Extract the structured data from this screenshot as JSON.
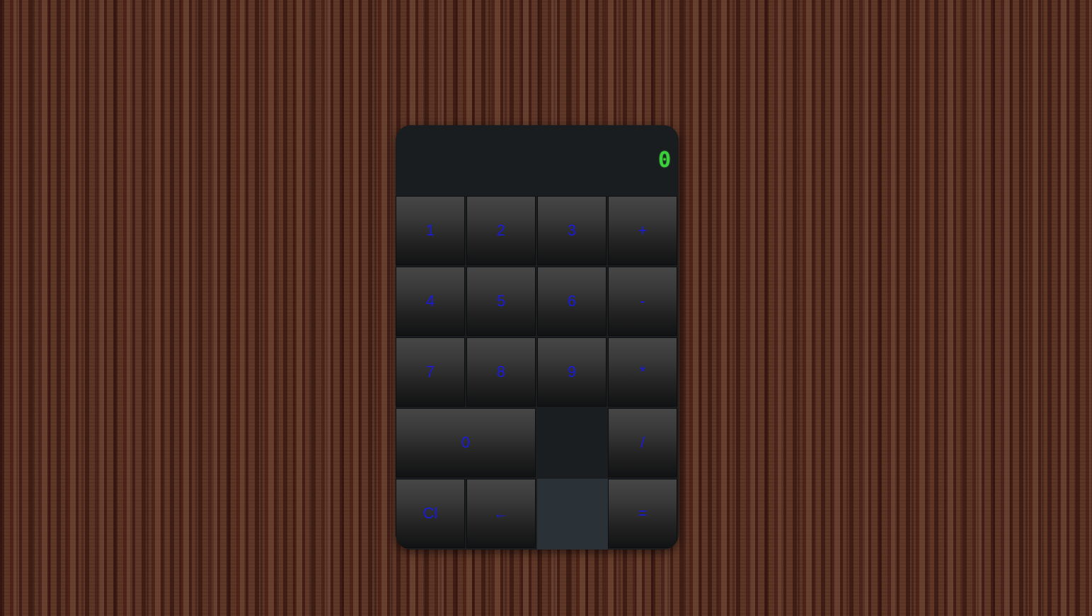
{
  "display": {
    "value": "0"
  },
  "keypad": {
    "rows": [
      [
        {
          "label": "1",
          "name": "key-1"
        },
        {
          "label": "2",
          "name": "key-2"
        },
        {
          "label": "3",
          "name": "key-3"
        },
        {
          "label": "+",
          "name": "key-plus"
        }
      ],
      [
        {
          "label": "4",
          "name": "key-4"
        },
        {
          "label": "5",
          "name": "key-5"
        },
        {
          "label": "6",
          "name": "key-6"
        },
        {
          "label": "-",
          "name": "key-minus"
        }
      ],
      [
        {
          "label": "7",
          "name": "key-7"
        },
        {
          "label": "8",
          "name": "key-8"
        },
        {
          "label": "9",
          "name": "key-9"
        },
        {
          "label": "*",
          "name": "key-multiply"
        }
      ],
      [
        {
          "label": "0",
          "name": "key-0"
        },
        {
          "label": "/",
          "name": "key-divide"
        }
      ],
      [
        {
          "label": "Cl",
          "name": "key-clear"
        },
        {
          "label": "←",
          "name": "key-backspace"
        },
        {
          "label": "=",
          "name": "key-equals"
        }
      ]
    ]
  },
  "colors": {
    "key_text": "#1a1adf",
    "display_text": "#3ad13a",
    "calculator_body": "#1b1e20"
  }
}
